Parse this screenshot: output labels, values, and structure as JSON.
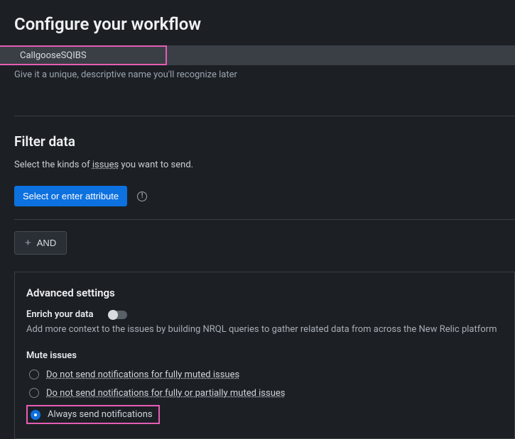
{
  "header": {
    "title": "Configure your workflow"
  },
  "name": {
    "value": "CallgooseSQIBS",
    "helper": "Give it a unique, descriptive name you'll recognize later"
  },
  "filter": {
    "title": "Filter data",
    "desc_prefix": "Select the kinds of ",
    "desc_underlined": "issues",
    "desc_suffix": " you want to send.",
    "select_attr_label": "Select or enter attribute",
    "and_label": "AND"
  },
  "advanced": {
    "title": "Advanced settings",
    "enrich_label": "Enrich your data",
    "enrich_desc": "Add more context to the issues by building NRQL queries to gather related data from across the New Relic platform",
    "mute_title": "Mute issues",
    "options": [
      "Do not send notifications for fully muted issues",
      "Do not send notifications for fully or partially muted issues",
      "Always send notifications"
    ]
  }
}
